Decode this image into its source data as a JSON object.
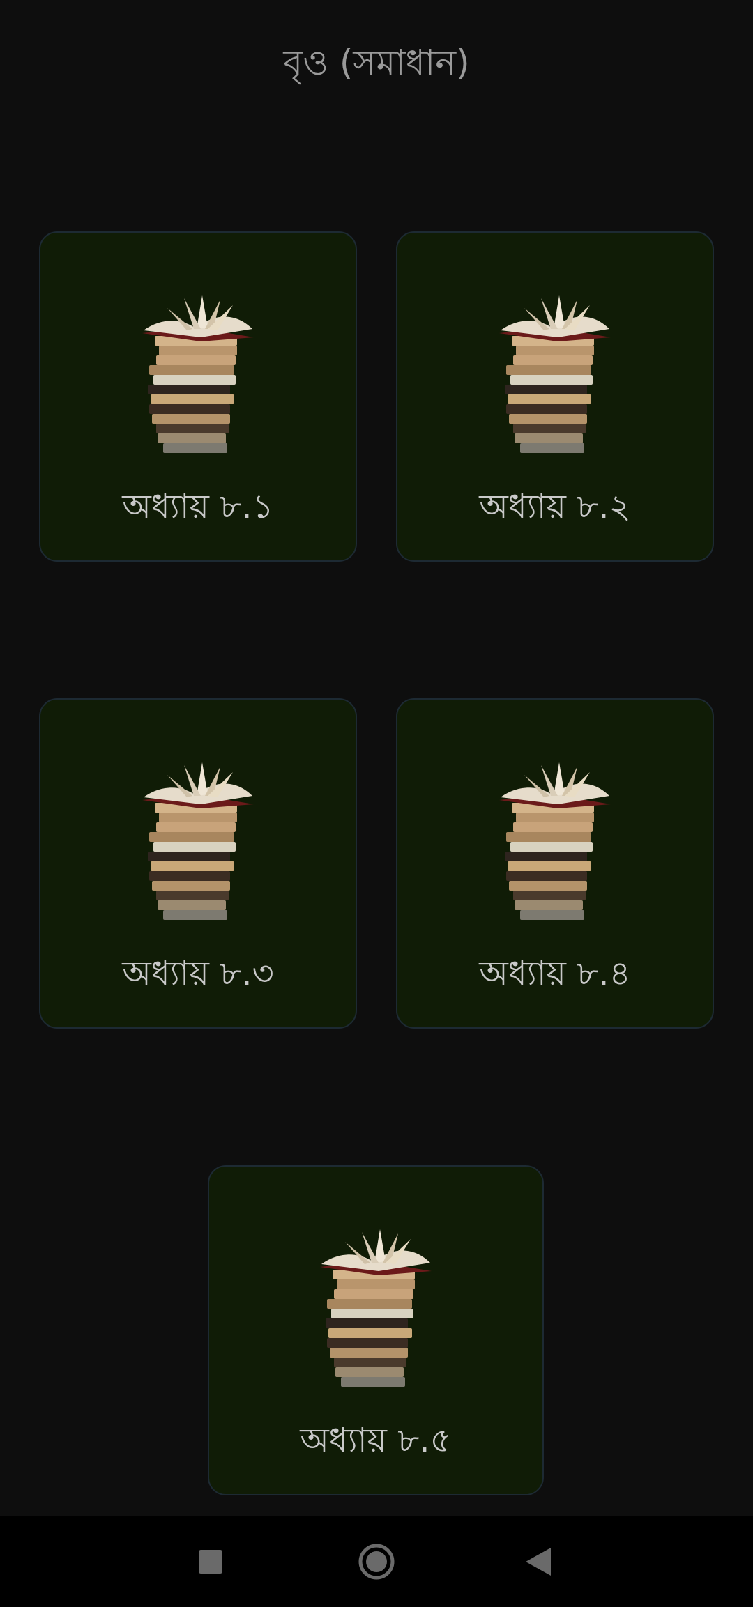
{
  "header": {
    "title": "বৃও (সমাধান)"
  },
  "cards": [
    {
      "label": "অধ্যায় ৮.১",
      "icon": "book-stack-icon"
    },
    {
      "label": "অধ্যায় ৮.২",
      "icon": "book-stack-icon"
    },
    {
      "label": "অধ্যায় ৮.৩",
      "icon": "book-stack-icon"
    },
    {
      "label": "অধ্যায় ৮.৪",
      "icon": "book-stack-icon"
    },
    {
      "label": "অধ্যায় ৮.৫",
      "icon": "book-stack-icon"
    }
  ],
  "navbar": {
    "buttons": [
      "recents-square-icon",
      "home-circle-icon",
      "back-triangle-icon"
    ]
  },
  "colors": {
    "background": "#0e0e0e",
    "card_background": "#101c06",
    "card_border": "#1d2a33",
    "title_text": "#9a9a9a",
    "label_text": "#c9c9c9",
    "navbar_background": "#000000",
    "navbar_icon": "#6a6a6a"
  }
}
